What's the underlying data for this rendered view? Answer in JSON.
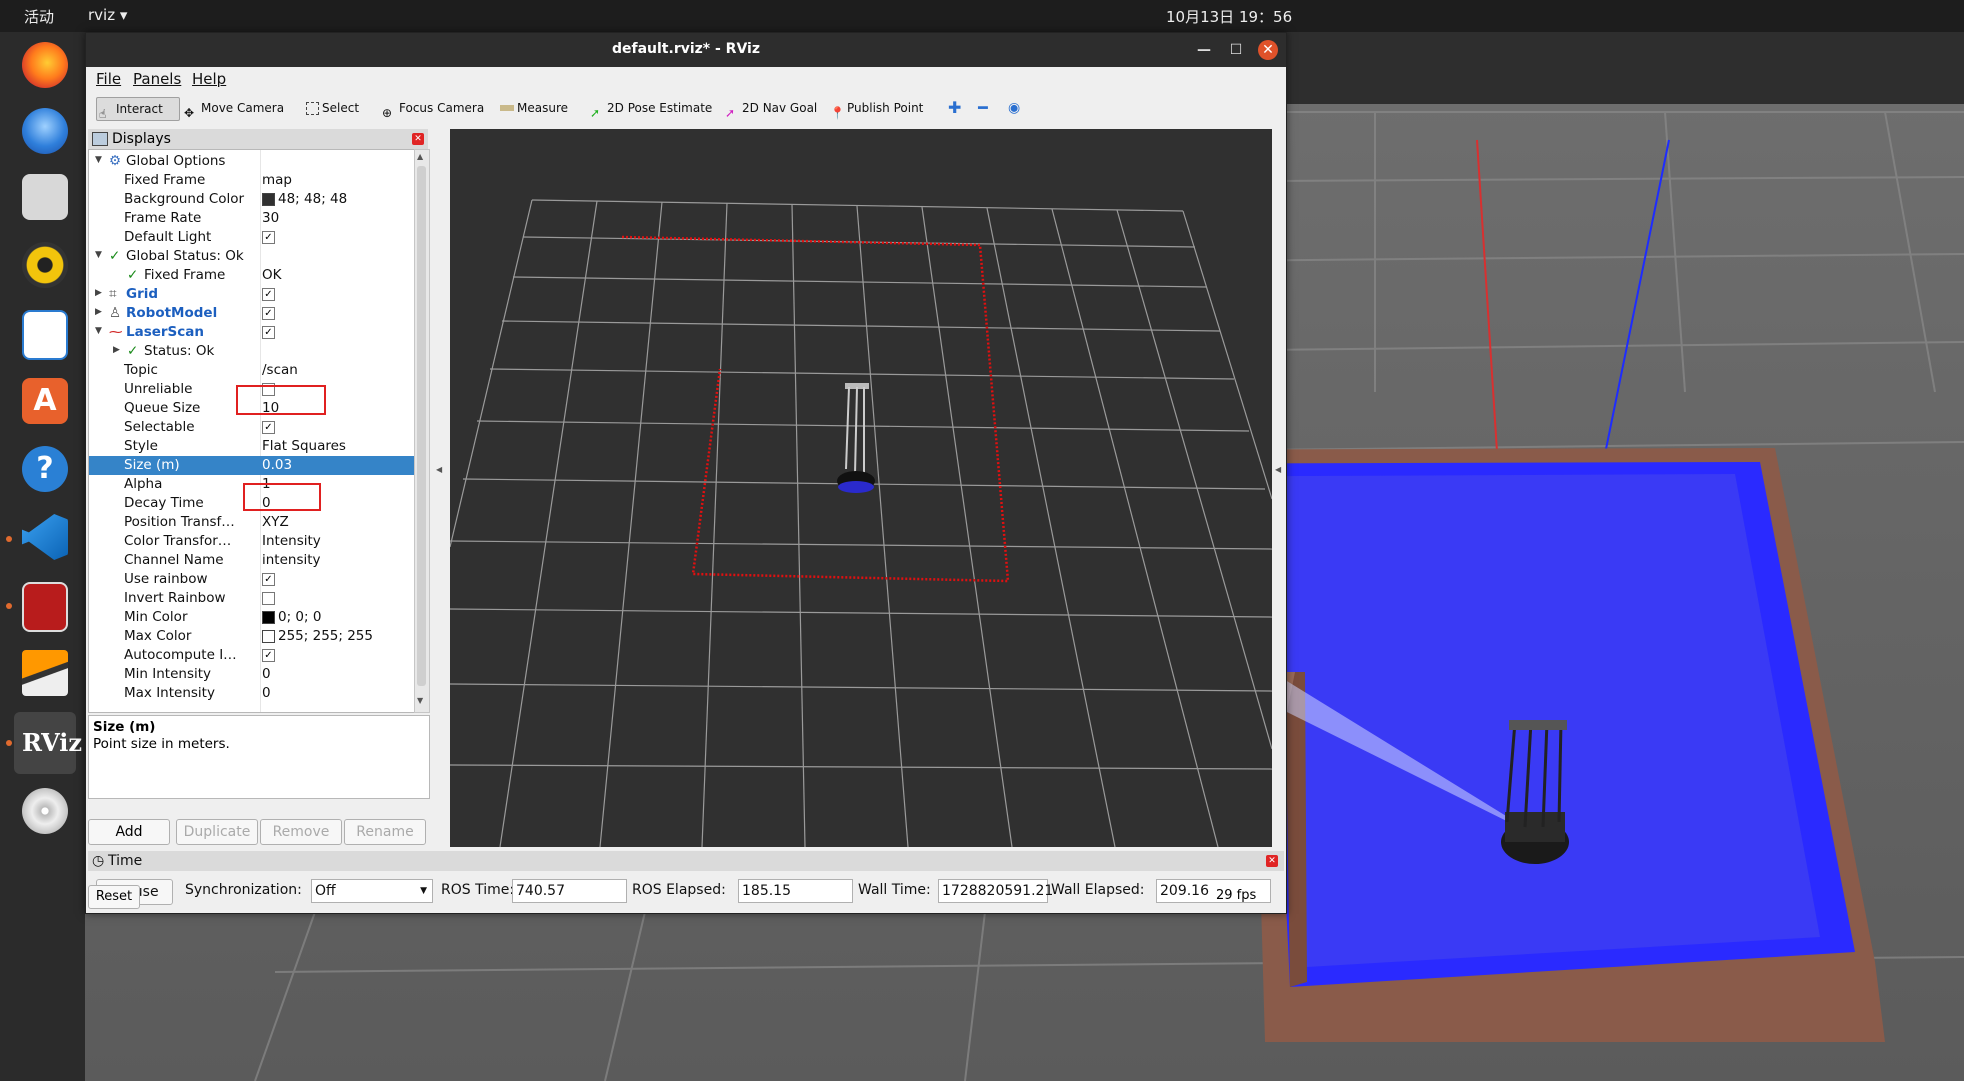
{
  "topbar": {
    "activities": "活动",
    "app_name": "rviz ▾",
    "clock": "10月13日  19：56"
  },
  "window": {
    "title": "default.rviz* - RViz"
  },
  "menu": {
    "file": "File",
    "panels": "Panels",
    "help": "Help"
  },
  "toolbar": {
    "interact": "Interact",
    "move_camera": "Move Camera",
    "select": "Select",
    "focus_camera": "Focus Camera",
    "measure": "Measure",
    "pose_estimate": "2D Pose Estimate",
    "nav_goal": "2D Nav Goal",
    "publish_point": "Publish Point"
  },
  "displays": {
    "title": "Displays",
    "rows": [
      {
        "k": "Global Options",
        "v": ""
      },
      {
        "k": "Fixed Frame",
        "v": "map"
      },
      {
        "k": "Background Color",
        "v": "48; 48; 48"
      },
      {
        "k": "Frame Rate",
        "v": "30"
      },
      {
        "k": "Default Light",
        "v": ""
      },
      {
        "k": "Global Status: Ok",
        "v": ""
      },
      {
        "k": "Fixed Frame",
        "v": "OK"
      },
      {
        "k": "Grid",
        "v": ""
      },
      {
        "k": "RobotModel",
        "v": ""
      },
      {
        "k": "LaserScan",
        "v": ""
      },
      {
        "k": "Status: Ok",
        "v": ""
      },
      {
        "k": "Topic",
        "v": "/scan"
      },
      {
        "k": "Unreliable",
        "v": ""
      },
      {
        "k": "Queue Size",
        "v": "10"
      },
      {
        "k": "Selectable",
        "v": ""
      },
      {
        "k": "Style",
        "v": "Flat Squares"
      },
      {
        "k": "Size (m)",
        "v": "0.03"
      },
      {
        "k": "Alpha",
        "v": "1"
      },
      {
        "k": "Decay Time",
        "v": "0"
      },
      {
        "k": "Position Transf…",
        "v": "XYZ"
      },
      {
        "k": "Color Transfor…",
        "v": "Intensity"
      },
      {
        "k": "Channel Name",
        "v": "intensity"
      },
      {
        "k": "Use rainbow",
        "v": ""
      },
      {
        "k": "Invert Rainbow",
        "v": ""
      },
      {
        "k": "Min Color",
        "v": "0; 0; 0"
      },
      {
        "k": "Max Color",
        "v": "255; 255; 255"
      },
      {
        "k": "Autocompute I…",
        "v": ""
      },
      {
        "k": "Min Intensity",
        "v": "0"
      },
      {
        "k": "Max Intensity",
        "v": "0"
      }
    ],
    "desc_title": "Size (m)",
    "desc_text": "Point size in meters.",
    "buttons": {
      "add": "Add",
      "duplicate": "Duplicate",
      "remove": "Remove",
      "rename": "Rename"
    }
  },
  "time": {
    "title": "Time",
    "pause": "Pause",
    "sync_label": "Synchronization:",
    "sync_value": "Off",
    "ros_time_label": "ROS Time:",
    "ros_time": "740.57",
    "ros_elapsed_label": "ROS Elapsed:",
    "ros_elapsed": "185.15",
    "wall_time_label": "Wall Time:",
    "wall_time": "1728820591.21",
    "wall_elapsed_label": "Wall Elapsed:",
    "wall_elapsed": "209.16",
    "reset": "Reset",
    "fps": "29 fps"
  },
  "colors": {
    "selection": "#3584c8",
    "laser": "#e01010",
    "accent_red": "#e02020"
  },
  "dock_icons": [
    "firefox-icon",
    "thunderbird-icon",
    "files-icon",
    "rhythmbox-icon",
    "writer-icon",
    "software-icon",
    "help-icon",
    "vscode-icon",
    "terminal-icon",
    "sublime-icon",
    "rviz-icon",
    "dvd-icon"
  ]
}
